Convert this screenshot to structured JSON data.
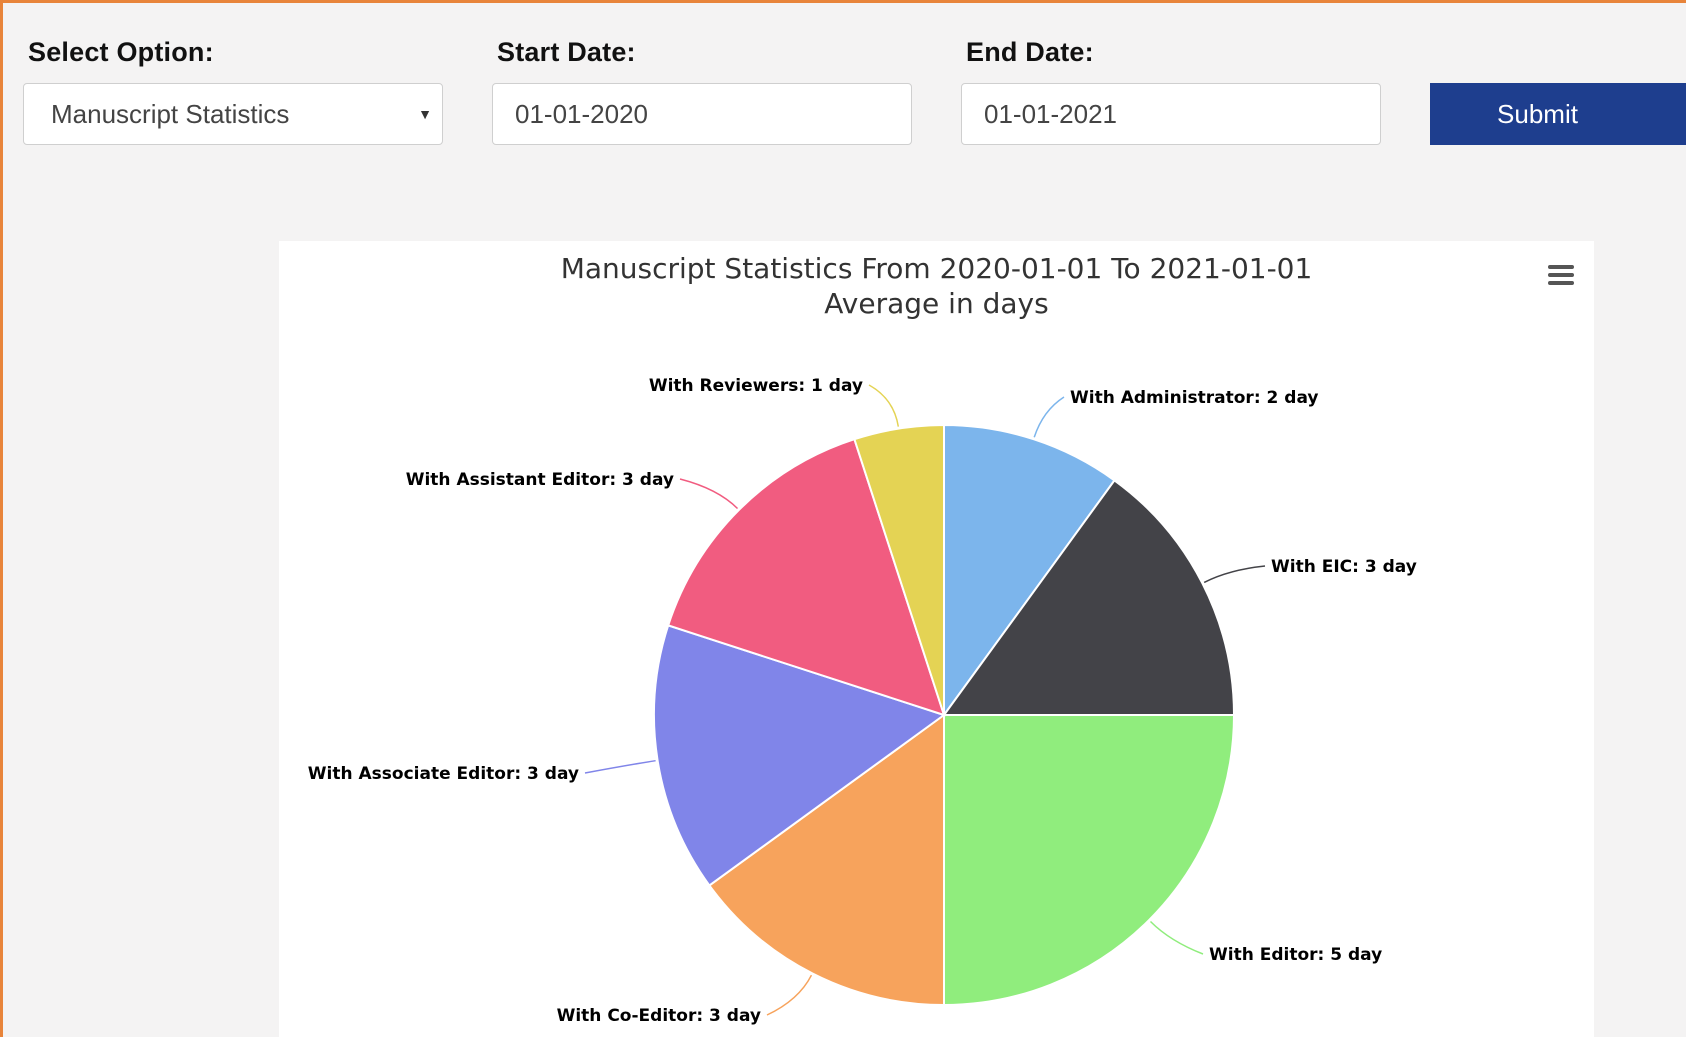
{
  "form": {
    "select_label": "Select Option:",
    "select_value": "Manuscript Statistics",
    "select_arrow": "▼",
    "start_label": "Start Date:",
    "start_value": "01-01-2020",
    "end_label": "End Date:",
    "end_value": "01-01-2021",
    "submit_label": "Submit"
  },
  "colors": {
    "frame_border": "#e8843a",
    "submit_bg": "#1e3e8e",
    "page_bg": "#f4f3f3"
  },
  "chart_menu_icon": "hamburger-menu-icon",
  "chart_data": {
    "type": "pie",
    "title": "Manuscript Statistics From 2020-01-01 To 2021-01-01",
    "subtitle": "Average in days",
    "slices": [
      {
        "name": "With Administrator",
        "value": 2,
        "label": "With Administrator: 2 day",
        "color": "#7cb5ec"
      },
      {
        "name": "With EIC",
        "value": 3,
        "label": "With EIC: 3 day",
        "color": "#434348"
      },
      {
        "name": "With Editor",
        "value": 5,
        "label": "With Editor: 5 day",
        "color": "#90ed7d"
      },
      {
        "name": "With Co-Editor",
        "value": 3,
        "label": "With Co-Editor: 3 day",
        "color": "#f7a35c"
      },
      {
        "name": "With Associate Editor",
        "value": 3,
        "label": "With Associate Editor: 3 day",
        "color": "#8085e9"
      },
      {
        "name": "With Assistant Editor",
        "value": 3,
        "label": "With Assistant Editor: 3 day",
        "color": "#f15c80"
      },
      {
        "name": "With Reviewers",
        "value": 1,
        "label": "With Reviewers: 1 day",
        "color": "#e4d354"
      }
    ]
  }
}
